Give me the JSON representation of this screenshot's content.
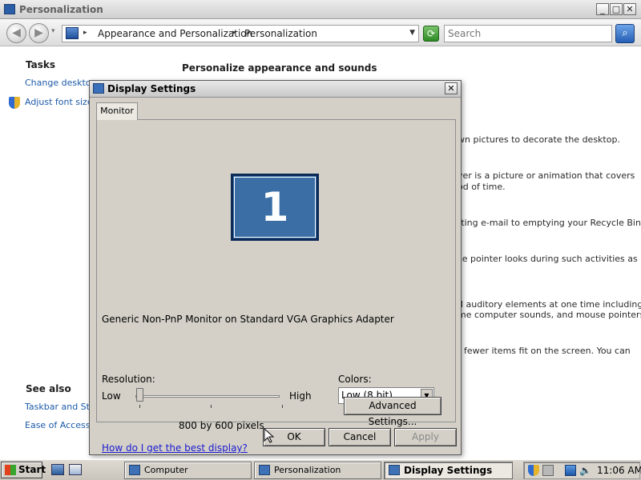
{
  "window": {
    "title": "Personalization",
    "controls": {
      "minimize": "_",
      "maximize": "□",
      "close": "✕"
    }
  },
  "nav": {
    "back": "◀",
    "forward": "▶",
    "breadcrumb": [
      "Appearance and Personalization",
      "Personalization"
    ],
    "search_placeholder": "Search"
  },
  "left_pane": {
    "tasks_heading": "Tasks",
    "tasks": [
      "Change desktop",
      "Adjust font size"
    ],
    "see_also_heading": "See also",
    "see_also": [
      "Taskbar and Sta",
      "Ease of Access"
    ]
  },
  "content": {
    "title": "Personalize appearance and sounds",
    "fragments": [
      "wn pictures to decorate the desktop.",
      "ver is a picture or animation that covers",
      "od of time.",
      "tting e-mail to emptying your Recycle Bin.",
      "se pointer looks during such activities as",
      "d auditory elements at one time including",
      "me computer sounds, and mouse pointers.",
      "r fewer items fit on the screen. You can"
    ]
  },
  "dialog": {
    "title": "Display Settings",
    "tab": "Monitor",
    "monitor_number": "1",
    "monitor_name": "Generic Non-PnP Monitor on Standard VGA Graphics Adapter",
    "resolution_label": "Resolution:",
    "low_label": "Low",
    "high_label": "High",
    "resolution_value": "800 by 600 pixels",
    "resolution_level": 0,
    "colors_label": "Colors:",
    "colors_value": "Low (8 bit)",
    "help_link": "How do I get the best display?",
    "advanced_button": "Advanced Settings...",
    "ok_button": "OK",
    "cancel_button": "Cancel",
    "apply_button": "Apply"
  },
  "taskbar": {
    "start": "Start",
    "tasks": [
      "Computer",
      "Personalization",
      "Display Settings"
    ],
    "clock": "11:06 AM"
  }
}
